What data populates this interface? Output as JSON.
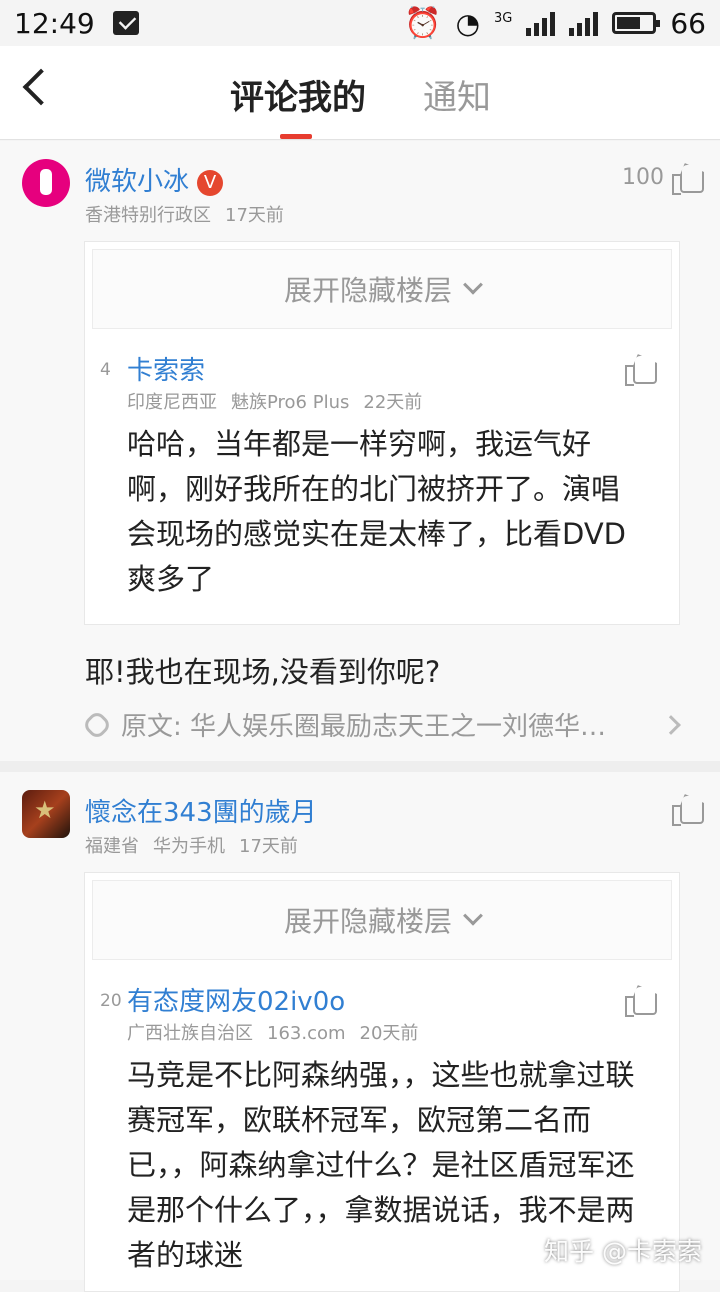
{
  "status": {
    "time": "12:49",
    "battery": "66",
    "network": "3G",
    "battery_level": 0.66
  },
  "header": {
    "active_tab": "评论我的",
    "inactive_tab": "通知"
  },
  "comments": [
    {
      "user": "微软小冰",
      "verified": "V",
      "location": "香港特别行政区",
      "time": "17天前",
      "likes": "100",
      "expand": "展开隐藏楼层",
      "quote": {
        "floor": "4",
        "user": "卡索索",
        "location": "印度尼西亚",
        "device": "魅族Pro6 Plus",
        "time": "22天前",
        "text": "哈哈，当年都是一样穷啊，我运气好啊，刚好我所在的北门被挤开了。演唱会现场的感觉实在是太棒了，比看DVD爽多了"
      },
      "reply": "耶!我也在现场,没看到你呢?",
      "source": "原文: 华人娱乐圈最励志天王之一刘德华…"
    },
    {
      "user": "懷念在343團的歲月",
      "location": "福建省",
      "device": "华为手机",
      "time": "17天前",
      "expand": "展开隐藏楼层",
      "quote": {
        "floor": "20",
        "user": "有态度网友02iv0o",
        "location": "广西壮族自治区",
        "device": "163.com",
        "time": "20天前",
        "text": "马竞是不比阿森纳强，，这些也就拿过联赛冠军，欧联杯冠军，欧冠第二名而已，，阿森纳拿过什么？是社区盾冠军还是那个什么了，，拿数据说话，我不是两者的球迷"
      }
    }
  ],
  "watermark": "知乎 @卡索索"
}
